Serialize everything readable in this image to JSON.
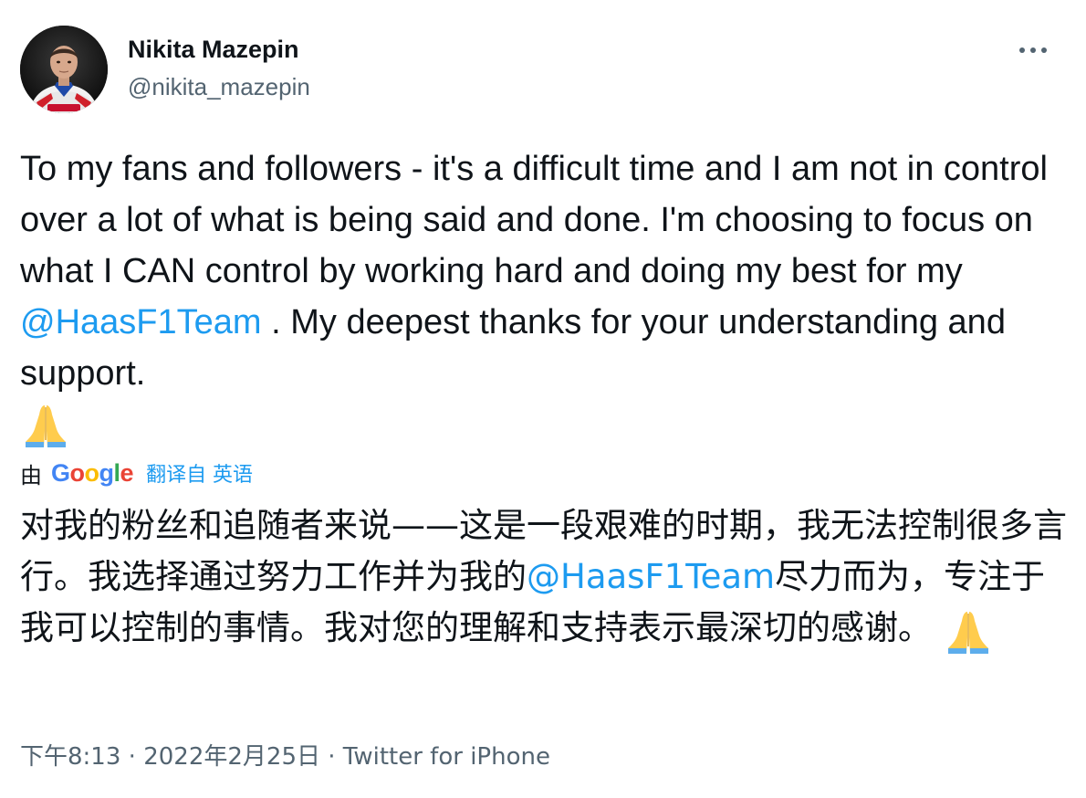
{
  "author": {
    "name": "Nikita Mazepin",
    "handle": "@nikita_mazepin",
    "avatar_icon": "profile-photo-icon"
  },
  "more_icon": "more-options-icon",
  "tweet": {
    "text_before_mention": "To my fans and followers - it's a difficult time and I am not in control over a lot of what is being said and done. I'm choosing to focus on what I CAN control by working hard and doing my best for my ",
    "mention": "@HaasF1Team",
    "text_after_mention": " . My deepest thanks for your understanding and support.",
    "emoji": "folded-hands-icon"
  },
  "translation": {
    "by_label": "由",
    "provider": "Google",
    "translated_from_label": "翻译自 英语",
    "text_before_mention": "对我的粉丝和追随者来说——这是一段艰难的时期，我无法控制很多言行。我选择通过努力工作并为我的",
    "mention": "@HaasF1Team",
    "text_after_mention": "尽力而为，专注于我可以控制的事情。我对您的理解和支持表示最深切的感谢。 "
  },
  "meta": {
    "time": "下午8:13",
    "separator1": " · ",
    "date": "2022年2月25日",
    "separator2": " · ",
    "source": "Twitter for iPhone"
  },
  "colors": {
    "link": "#1d9bf0",
    "secondary_text": "#536471",
    "primary_text": "#0f1419"
  }
}
